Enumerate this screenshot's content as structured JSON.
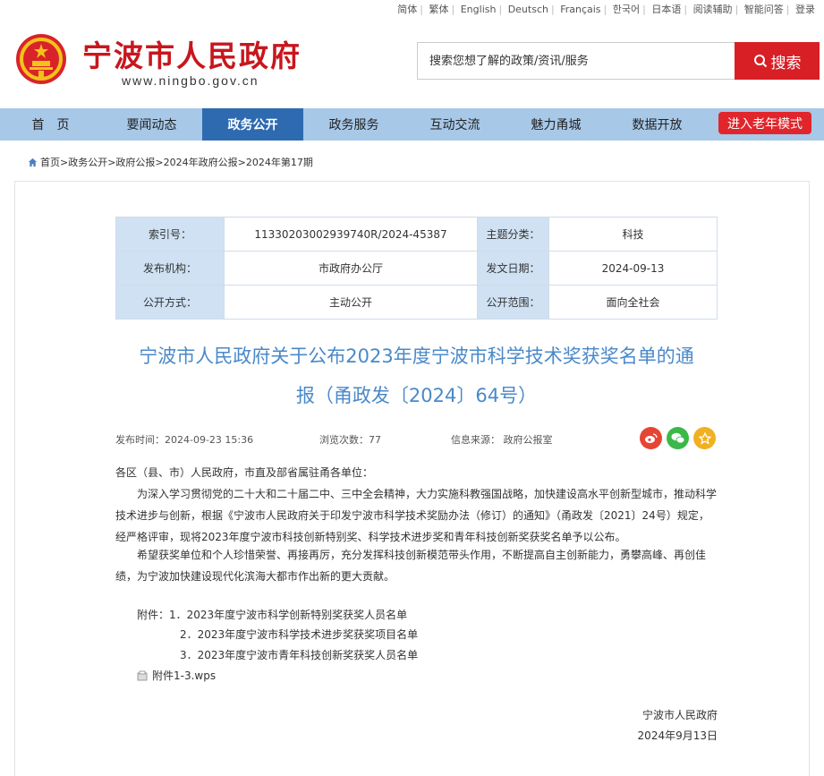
{
  "top_links": [
    "简体",
    "繁体",
    "English",
    "Deutsch",
    "Français",
    "한국어",
    "日本语",
    "阅读辅助",
    "智能问答",
    "登录"
  ],
  "header": {
    "title": "宁波市人民政府",
    "url": "www.ningbo.gov.cn"
  },
  "search": {
    "placeholder": "搜索您想了解的政策/资讯/服务",
    "button_label": "搜索"
  },
  "nav": {
    "items": [
      "首　页",
      "要闻动态",
      "政务公开",
      "政务服务",
      "互动交流",
      "魅力甬城",
      "数据开放"
    ],
    "active_index": 2,
    "elder_label": "进入老年模式"
  },
  "breadcrumb": "首页>政务公开>政府公报>2024年政府公报>2024年第17期",
  "meta": {
    "index_label": "索引号：",
    "index_value": "11330203002939740R/2024-45387",
    "topic_label": "主题分类：",
    "topic_value": "科技",
    "publisher_label": "发布机构：",
    "publisher_value": "市政府办公厅",
    "date_label": "发文日期：",
    "date_value": "2024-09-13",
    "method_label": "公开方式：",
    "method_value": "主动公开",
    "scope_label": "公开范围：",
    "scope_value": "面向全社会"
  },
  "doc": {
    "title_line1": "宁波市人民政府关于公布2023年度宁波市科学技术奖获奖名单的通",
    "title_line2": "报（甬政发〔2024〕64号）",
    "publish_time": "发布时间：2024-09-23 15:36",
    "views": "浏览次数：77",
    "source": "信息来源：  政府公报室",
    "salutation": "各区（县、市）人民政府，市直及部省属驻甬各单位：",
    "para1": "　　为深入学习贯彻党的二十大和二十届二中、三中全会精神，大力实施科教强国战略，加快建设高水平创新型城市，推动科学技术进步与创新，根据《宁波市人民政府关于印发宁波市科学技术奖励办法（修订）的通知》（甬政发〔2021〕24号）规定，经严格评审，现将2023年度宁波市科技创新特别奖、科学技术进步奖和青年科技创新奖获奖名单予以公布。",
    "para2": "　　希望获奖单位和个人珍惜荣誉、再接再厉，充分发挥科技创新模范带头作用，不断提高自主创新能力，勇攀高峰、再创佳绩，为宁波加快建设现代化滨海大都市作出新的更大贡献。",
    "attach1": "附件：1．2023年度宁波市科学创新特别奖获奖人员名单",
    "attach2": "2．2023年度宁波市科学技术进步奖获奖项目名单",
    "attach3": "3．2023年度宁波市青年科技创新奖获奖人员名单",
    "file": "附件1-3.wps",
    "sign_org": "宁波市人民政府",
    "sign_date": "2024年9月13日"
  },
  "colors": {
    "brand_red": "#c8161d",
    "nav_bg": "#a8c8e8",
    "nav_active": "#2e6ab0",
    "title_blue": "#4a89c9"
  }
}
